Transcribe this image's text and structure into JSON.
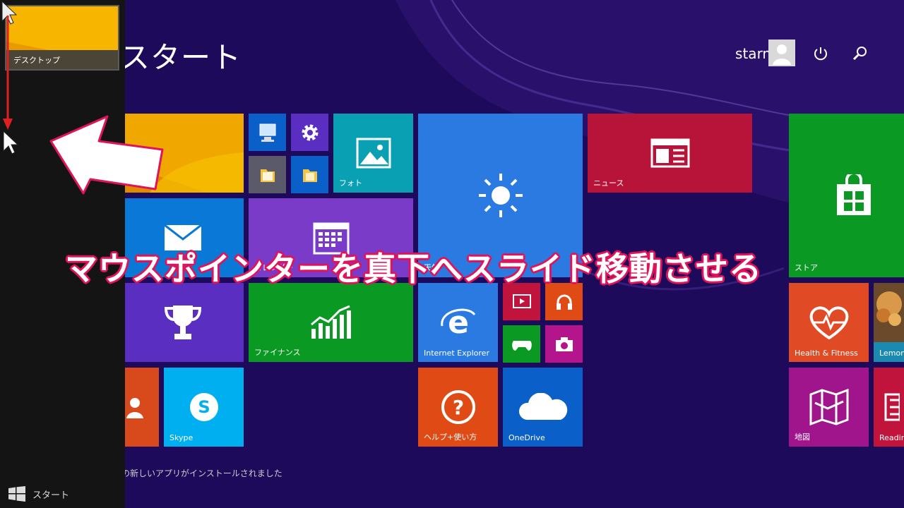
{
  "colors": {
    "background": "#1e0a5a",
    "accent_pink": "#e0145a",
    "switcher_bg": "#141414"
  },
  "start_screen": {
    "title": "スタート",
    "user_name": "starmint",
    "icons": {
      "avatar": "user-icon",
      "power": "power-icon",
      "search": "search-icon"
    },
    "notice": "の新しいアプリがインストールされました"
  },
  "switcher": {
    "desktop_label": "デスクトップ",
    "start_label": "スタート"
  },
  "annotation": {
    "text": "マウスポインターを真下へスライド移動させる"
  },
  "tiles": {
    "photos": "フォト",
    "news": "ニュース",
    "calendar": "カレンダー",
    "weather": "天気",
    "store": "ストア",
    "finance": "ファイナンス",
    "ie": "Internet Explorer",
    "health": "Health & Fitness",
    "food": "Lemon",
    "skype": "Skype",
    "help": "ヘルプ+使い方",
    "onedrive": "OneDrive",
    "maps": "地図",
    "reading": "Reading"
  }
}
